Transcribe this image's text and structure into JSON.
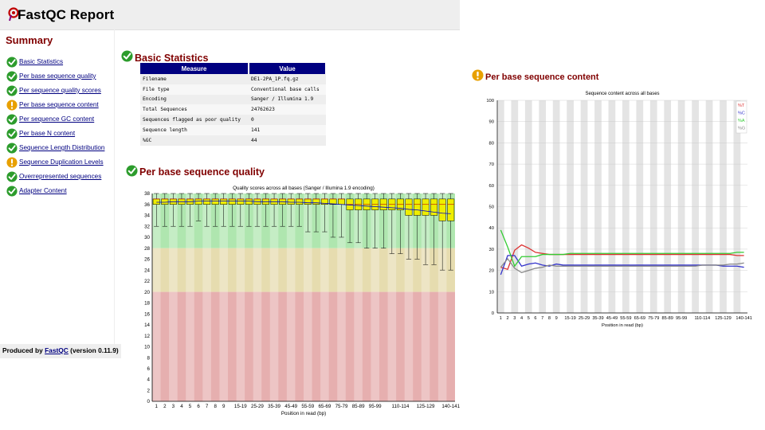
{
  "header": {
    "title": "FastQC Report",
    "logo_icon": "fastqc-logo-icon"
  },
  "summary": {
    "title": "Summary",
    "items": [
      {
        "label": "Basic Statistics",
        "status": "pass"
      },
      {
        "label": "Per base sequence quality",
        "status": "pass"
      },
      {
        "label": "Per sequence quality scores",
        "status": "pass"
      },
      {
        "label": "Per base sequence content",
        "status": "warn"
      },
      {
        "label": "Per sequence GC content",
        "status": "pass"
      },
      {
        "label": "Per base N content",
        "status": "pass"
      },
      {
        "label": "Sequence Length Distribution",
        "status": "pass"
      },
      {
        "label": "Sequence Duplication Levels",
        "status": "warn"
      },
      {
        "label": "Overrepresented sequences",
        "status": "pass"
      },
      {
        "label": "Adapter Content",
        "status": "pass"
      }
    ]
  },
  "footer": {
    "prefix": "Produced by ",
    "link": "FastQC",
    "suffix": " (version 0.11.9)"
  },
  "colors": {
    "title_red": "#800000",
    "link_blue": "#000080",
    "pass_green": "#2c9c2c",
    "warn_orange": "#e8a000"
  },
  "basic_stats": {
    "title": "Basic Statistics",
    "columns": [
      "Measure",
      "Value"
    ],
    "rows": [
      [
        "Filename",
        "DE1-2PA_1P.fq.gz"
      ],
      [
        "File type",
        "Conventional base calls"
      ],
      [
        "Encoding",
        "Sanger / Illumina 1.9"
      ],
      [
        "Total Sequences",
        "24762623"
      ],
      [
        "Sequences flagged as poor quality",
        "0"
      ],
      [
        "Sequence length",
        "141"
      ],
      [
        "%GC",
        "44"
      ]
    ]
  },
  "quality": {
    "title": "Per base sequence quality"
  },
  "content": {
    "title": "Per base sequence content"
  },
  "chart_data": [
    {
      "type": "boxplot",
      "title": "Quality scores across all bases (Sanger / Illumina 1.9 encoding)",
      "xlabel": "Position in read (bp)",
      "ylabel": "",
      "ylim": [
        0,
        38
      ],
      "yticks": [
        0,
        2,
        4,
        6,
        8,
        10,
        12,
        14,
        16,
        18,
        20,
        22,
        24,
        26,
        28,
        30,
        32,
        34,
        36,
        38
      ],
      "categories": [
        "1",
        "2",
        "3",
        "4",
        "5",
        "6",
        "7",
        "8",
        "9",
        "10-14",
        "15-19",
        "20-24",
        "25-29",
        "30-34",
        "35-39",
        "40-44",
        "45-49",
        "50-54",
        "55-59",
        "60-64",
        "65-69",
        "70-74",
        "75-79",
        "80-84",
        "85-89",
        "90-94",
        "95-99",
        "100-104",
        "105-109",
        "110-114",
        "115-119",
        "120-124",
        "125-129",
        "130-134",
        "135-139",
        "140-141"
      ],
      "xtick_labels": [
        "1",
        "2",
        "3",
        "4",
        "5",
        "6",
        "7",
        "8",
        "9",
        "15-19",
        "25-29",
        "35-39",
        "45-49",
        "55-59",
        "65-69",
        "75-79",
        "85-89",
        "95-99",
        "110-114",
        "125-129",
        "140-141"
      ],
      "bands": [
        {
          "from": 28,
          "to": 38,
          "color": "#afe6af"
        },
        {
          "from": 20,
          "to": 28,
          "color": "#e6dcaf"
        },
        {
          "from": 0,
          "to": 20,
          "color": "#e6afaf"
        }
      ],
      "boxes": {
        "lower_whisker": [
          32,
          32,
          32,
          32,
          32,
          33,
          32,
          32,
          32,
          32,
          32,
          32,
          32,
          32,
          32,
          32,
          32,
          32,
          31,
          31,
          31,
          30,
          30,
          29,
          29,
          28,
          28,
          28,
          27,
          27,
          26,
          26,
          25,
          25,
          24,
          24
        ],
        "lower_quartile": [
          36,
          36,
          36,
          36,
          36,
          36,
          36,
          36,
          36,
          36,
          36,
          36,
          36,
          36,
          36,
          36,
          36,
          36,
          36,
          36,
          36,
          36,
          36,
          35,
          35,
          35,
          35,
          35,
          35,
          35,
          34,
          34,
          34,
          34,
          33,
          33
        ],
        "median": [
          37,
          37,
          37,
          37,
          37,
          37,
          37,
          37,
          37,
          37,
          37,
          37,
          37,
          37,
          37,
          37,
          37,
          37,
          37,
          37,
          37,
          37,
          37,
          36,
          36,
          36,
          36,
          36,
          36,
          36,
          36,
          36,
          36,
          36,
          36,
          36
        ],
        "upper_quartile": [
          37,
          37,
          37,
          37,
          37,
          37,
          37,
          37,
          37,
          37,
          37,
          37,
          37,
          37,
          37,
          37,
          37,
          37,
          37,
          37,
          37,
          37,
          37,
          37,
          37,
          37,
          37,
          37,
          37,
          37,
          37,
          37,
          37,
          37,
          37,
          37
        ],
        "upper_whisker": [
          38,
          38,
          38,
          38,
          38,
          38,
          38,
          38,
          38,
          38,
          38,
          38,
          38,
          38,
          38,
          38,
          38,
          38,
          38,
          38,
          38,
          38,
          38,
          38,
          38,
          38,
          38,
          38,
          38,
          38,
          38,
          38,
          38,
          38,
          38,
          38
        ],
        "mean": [
          36.4,
          36.4,
          36.5,
          36.5,
          36.5,
          36.6,
          36.6,
          36.6,
          36.6,
          36.6,
          36.6,
          36.6,
          36.5,
          36.5,
          36.5,
          36.5,
          36.4,
          36.4,
          36.3,
          36.3,
          36.2,
          36.1,
          36.0,
          35.9,
          35.8,
          35.7,
          35.6,
          35.5,
          35.4,
          35.3,
          35.1,
          35.0,
          34.8,
          34.6,
          34.4,
          34.3
        ]
      }
    },
    {
      "type": "line",
      "title": "Sequence content across all bases",
      "xlabel": "Position in read (bp)",
      "ylabel": "",
      "ylim": [
        0,
        100
      ],
      "yticks": [
        0,
        10,
        20,
        30,
        40,
        50,
        60,
        70,
        80,
        90,
        100
      ],
      "categories": [
        "1",
        "2",
        "3",
        "4",
        "5",
        "6",
        "7",
        "8",
        "9",
        "10-14",
        "15-19",
        "20-24",
        "25-29",
        "30-34",
        "35-39",
        "40-44",
        "45-49",
        "50-54",
        "55-59",
        "60-64",
        "65-69",
        "70-74",
        "75-79",
        "80-84",
        "85-89",
        "90-94",
        "95-99",
        "100-104",
        "105-109",
        "110-114",
        "115-119",
        "120-124",
        "125-129",
        "130-134",
        "135-139",
        "140-141"
      ],
      "xtick_labels": [
        "1",
        "2",
        "3",
        "4",
        "5",
        "6",
        "7",
        "8",
        "9",
        "15-19",
        "25-29",
        "35-39",
        "45-49",
        "55-59",
        "65-69",
        "75-79",
        "85-89",
        "95-99",
        "110-114",
        "125-129",
        "140-141"
      ],
      "legend_position": "top-right",
      "series": [
        {
          "name": "%T",
          "color": "#dd3333",
          "values": [
            21.5,
            20.5,
            29.5,
            32.0,
            30.5,
            28.5,
            28.0,
            27.5,
            27.5,
            27.5,
            27.5,
            27.5,
            27.5,
            27.5,
            27.5,
            27.5,
            27.5,
            27.5,
            27.5,
            27.5,
            27.5,
            27.5,
            27.5,
            27.5,
            27.5,
            27.5,
            27.5,
            27.5,
            27.5,
            27.5,
            27.5,
            27.5,
            27.5,
            27.5,
            27.0,
            27.0
          ]
        },
        {
          "name": "%C",
          "color": "#3333cc",
          "values": [
            18.0,
            27.0,
            27.0,
            22.0,
            23.0,
            23.5,
            22.5,
            22.0,
            23.0,
            22.5,
            22.5,
            22.5,
            22.5,
            22.5,
            22.5,
            22.5,
            22.5,
            22.5,
            22.5,
            22.5,
            22.5,
            22.5,
            22.5,
            22.5,
            22.5,
            22.5,
            22.5,
            22.5,
            22.5,
            22.5,
            22.5,
            22.5,
            22.0,
            22.0,
            22.0,
            21.5
          ]
        },
        {
          "name": "%A",
          "color": "#33cc33",
          "values": [
            39.0,
            31.0,
            22.0,
            26.5,
            26.5,
            26.5,
            27.5,
            27.5,
            27.5,
            27.5,
            28.0,
            28.0,
            28.0,
            28.0,
            28.0,
            28.0,
            28.0,
            28.0,
            28.0,
            28.0,
            28.0,
            28.0,
            28.0,
            28.0,
            28.0,
            28.0,
            28.0,
            28.0,
            28.0,
            28.0,
            28.0,
            28.0,
            28.0,
            28.0,
            28.5,
            28.5
          ]
        },
        {
          "name": "%G",
          "color": "#888888",
          "values": [
            21.5,
            25.5,
            21.0,
            19.0,
            20.0,
            21.0,
            21.5,
            22.5,
            22.0,
            22.0,
            22.0,
            22.0,
            22.0,
            22.0,
            22.0,
            22.0,
            22.0,
            22.0,
            22.0,
            22.0,
            22.0,
            22.0,
            22.0,
            22.0,
            22.0,
            22.0,
            22.0,
            22.0,
            22.0,
            22.5,
            22.5,
            22.5,
            22.5,
            23.0,
            23.0,
            23.5
          ]
        }
      ]
    }
  ]
}
